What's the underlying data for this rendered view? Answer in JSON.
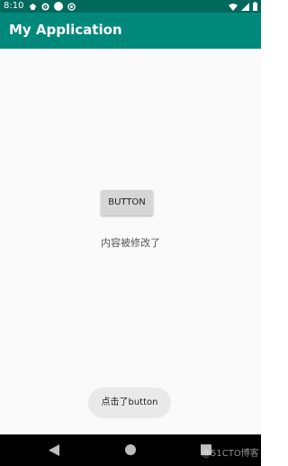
{
  "status_bar": {
    "time": "8:10",
    "left_icons": [
      "notification-icon",
      "settings-icon",
      "circle-icon",
      "sync-icon"
    ],
    "right_icons": [
      "wifi-icon",
      "signal-icon",
      "battery-icon"
    ]
  },
  "app_bar": {
    "title": "My Application",
    "color": "#00897b"
  },
  "main": {
    "button_label": "BUTTON",
    "message": "内容被修改了"
  },
  "toast": {
    "text": "点击了button"
  },
  "nav_bar": {
    "icons": [
      "back-icon",
      "home-icon",
      "recents-icon"
    ]
  },
  "watermark": {
    "text": "@51CTO博客"
  }
}
